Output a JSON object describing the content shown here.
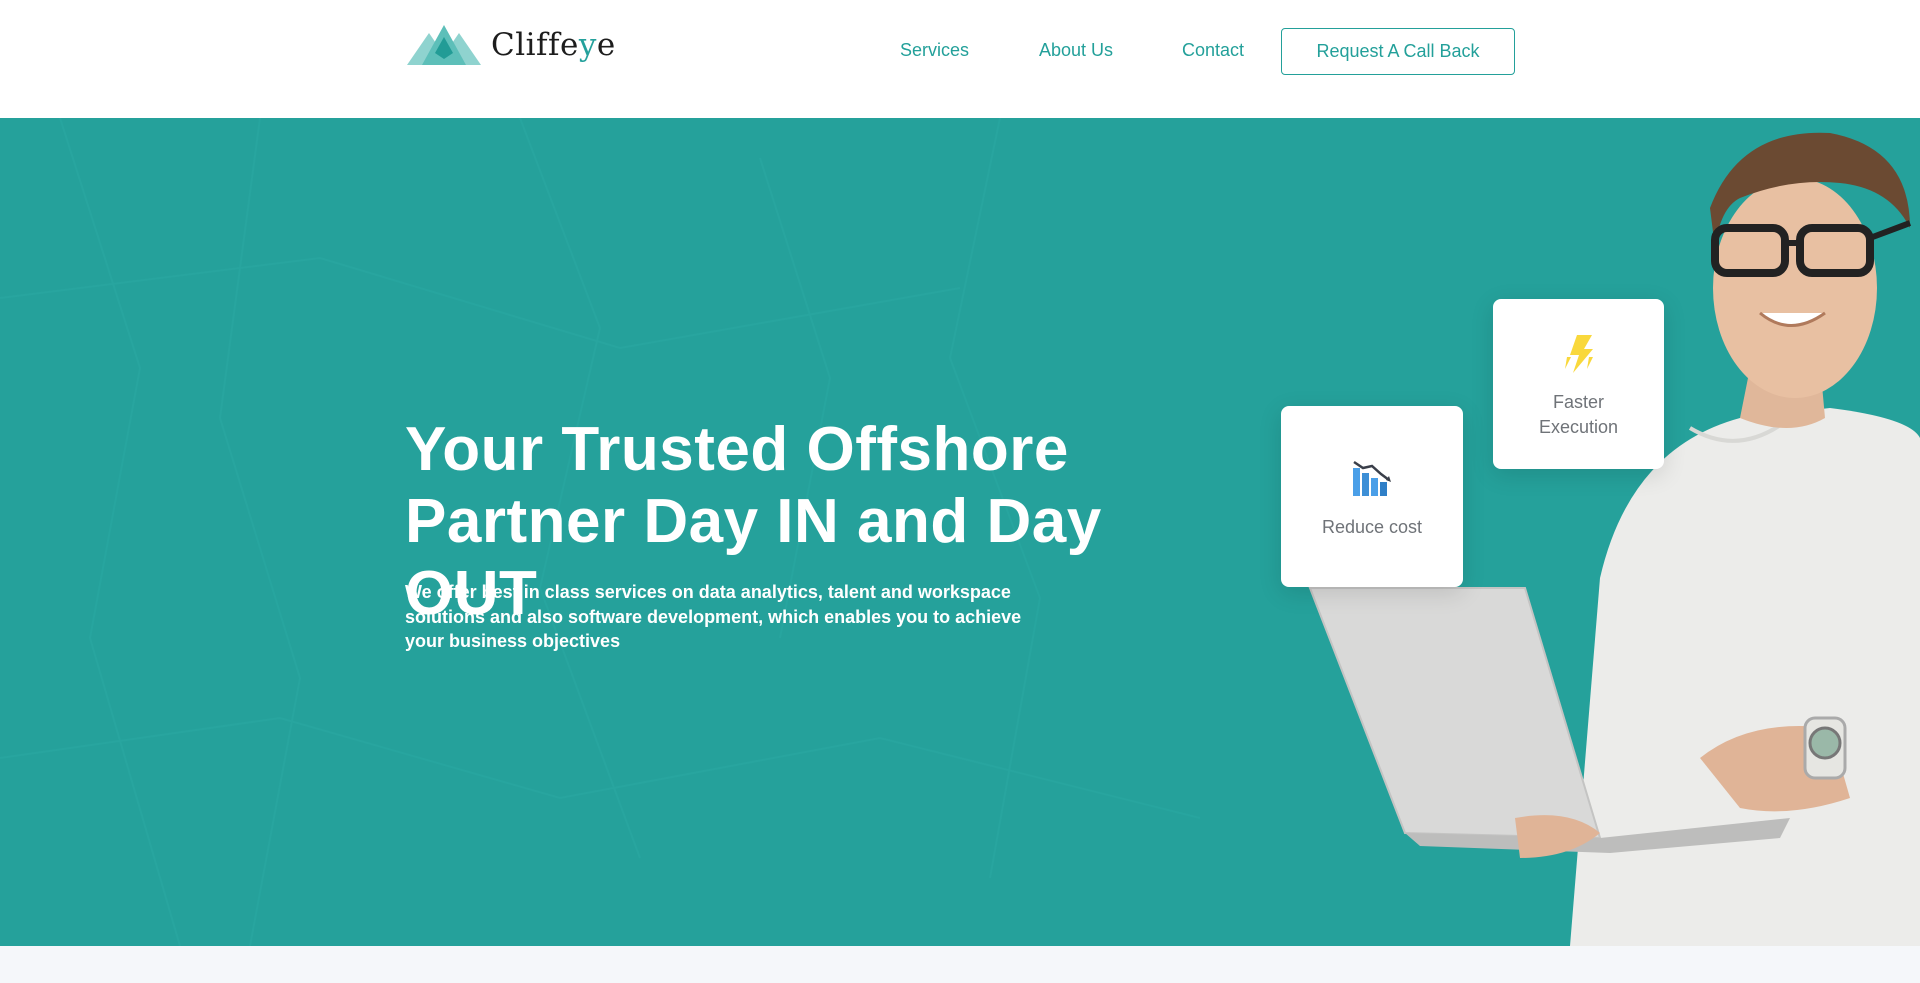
{
  "header": {
    "logo": {
      "text_main": "Cliffe",
      "text_accent": "y",
      "text_end": "e"
    },
    "nav": [
      {
        "label": "Services"
      },
      {
        "label": "About Us"
      },
      {
        "label": "Contact"
      }
    ],
    "cta_label": "Request A Call Back"
  },
  "hero": {
    "title": "Your Trusted Offshore Partner Day IN and Day OUT",
    "subtitle": "We offer best in class services on data analytics, talent and workspace solutions and also software development, which enables you to achieve your business objectives",
    "cards": [
      {
        "label": "Reduce cost",
        "icon": "bar-chart-decline-icon"
      },
      {
        "label": "Faster Execution",
        "icon": "lightning-bolt-icon"
      }
    ]
  },
  "colors": {
    "brand_teal": "#25a19b",
    "text_teal": "#23a09a",
    "white": "#ffffff",
    "card_text": "#6f7378",
    "bolt_yellow": "#f9d83c",
    "chart_blue": "#4a9fe8"
  }
}
